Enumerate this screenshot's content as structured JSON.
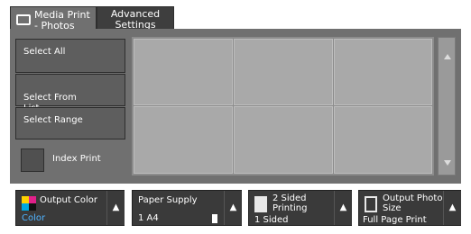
{
  "tabs": {
    "media_print": "Media Print\n- Photos",
    "advanced": "Advanced\nSettings"
  },
  "left": {
    "select_all": "Select All",
    "select_from_list": "Select From\nList...",
    "select_range": "Select Range",
    "index_print": "Index Print"
  },
  "bottom": {
    "output_color": {
      "label": "Output Color",
      "value": "Color"
    },
    "paper_supply": {
      "label": "Paper Supply",
      "value": "1 A4"
    },
    "two_sided": {
      "label": "2 Sided\nPrinting",
      "value": "1 Sided"
    },
    "output_photo_size": {
      "label": "Output Photo\nSize",
      "value": "Full Page Print"
    }
  },
  "colors": {
    "color_value": "#4fb3ff",
    "panel": "#707070",
    "dark_button": "#3a3a3a"
  }
}
